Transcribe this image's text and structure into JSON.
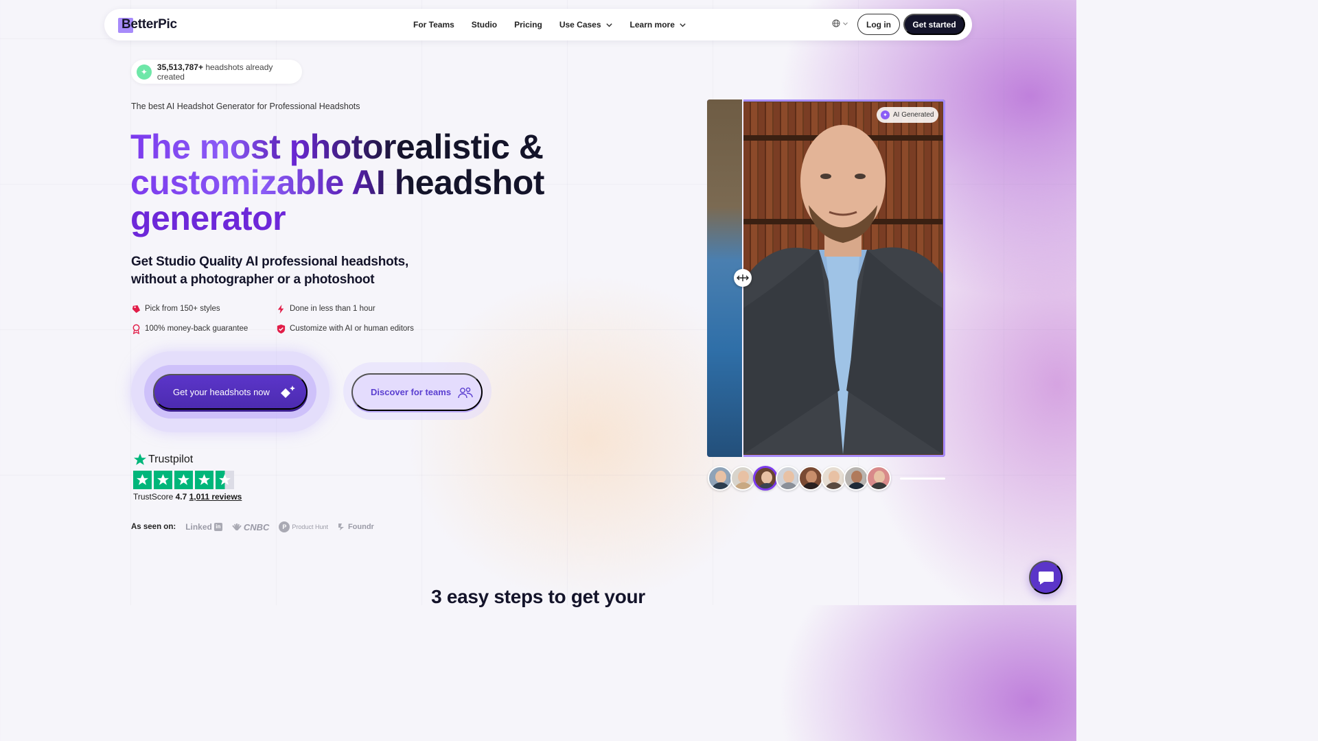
{
  "nav": {
    "logo": "BetterPic",
    "links": [
      {
        "label": "For Teams"
      },
      {
        "label": "Studio"
      },
      {
        "label": "Pricing"
      },
      {
        "label": "Use Cases",
        "dropdown": true
      },
      {
        "label": "Learn more",
        "dropdown": true
      }
    ],
    "language_icon": "globe-icon",
    "login_label": "Log in",
    "cta_label": "Get started"
  },
  "hero": {
    "counter_value": "35,513,787+",
    "counter_text": " headshots already created",
    "eyebrow": "The best AI Headshot Generator for Professional Headshots",
    "headline": {
      "line1_a": "The most ",
      "line1_b": "photorealistic &",
      "line2_a": "customizable ",
      "line2_b": "AI headshot",
      "line3": "generator"
    },
    "subhead_line1": "Get Studio Quality AI professional headshots,",
    "subhead_line2": "without a photographer or a photoshoot",
    "features": [
      {
        "icon": "tag-icon",
        "text": "Pick from 150+ styles"
      },
      {
        "icon": "lightning-icon",
        "text": "Done in less than 1 hour"
      },
      {
        "icon": "badge-icon",
        "text": "100% money-back guarantee"
      },
      {
        "icon": "shield-check-icon",
        "text": "Customize with AI or human editors"
      }
    ],
    "primary_cta": "Get your headshots now",
    "secondary_cta": "Discover for teams"
  },
  "trustpilot": {
    "brand": "Trustpilot",
    "score_label": "TrustScore",
    "score": "4.7",
    "reviews": "1,011 reviews",
    "stars": 4.5
  },
  "as_seen_on": {
    "label": "As seen on:",
    "outlets": [
      "Linked",
      "CNBC",
      "Product Hunt",
      "Foundr"
    ]
  },
  "preview": {
    "badge": "AI Generated",
    "slider_position": 0.15,
    "thumbnail_count": 8,
    "active_thumbnail": 3,
    "progress": 1.0
  },
  "next_section": {
    "title": "3 easy steps to get your"
  },
  "colors": {
    "brand": "#5b35c9",
    "accent": "#8b5cf6",
    "dark": "#14142a",
    "trustpilot": "#00b67a"
  }
}
